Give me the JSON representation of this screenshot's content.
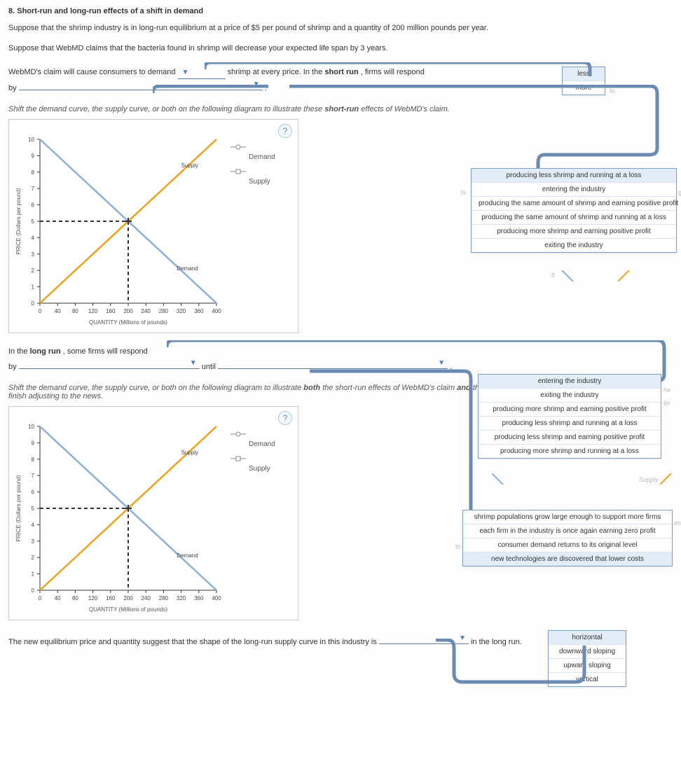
{
  "title": "8. Short-run and long-run effects of a shift in demand",
  "intro1": "Suppose that the shrimp industry is in long-run equilibrium at a price of $5 per pound of shrimp and a quantity of 200 million pounds per year.",
  "intro2": "Suppose that WebMD claims that the bacteria found in shrimp will decrease your expected life span by 3 years.",
  "sentence1_a": "WebMD's claim will cause consumers to demand ",
  "sentence1_b": " shrimp at every price. In the ",
  "sentence1_c": "short run",
  "sentence1_d": ", firms will respond",
  "sentence1_by": "by ",
  "sentence1_end": " .",
  "instr1": "Shift the demand curve, the supply curve, or both on the following diagram to illustrate these ",
  "instr1b": "short-run",
  "instr1c": " effects of WebMD's claim.",
  "sentence2_a": "In the ",
  "sentence2_b": "long run",
  "sentence2_c": ", some firms will respond",
  "sentence2_by": "by ",
  "sentence2_until": " until ",
  "sentence2_end": " .",
  "instr2a": "Shift the demand curve, the supply curve, or both on the following diagram to illustrate ",
  "instr2b": "both",
  "instr2c": " the short-run effects of WebMD's claim ",
  "instr2d": "and",
  "instr2e": " the new long-run equilibrium after firms and consumers finish adjusting to the news.",
  "sentence3_a": "The new equilibrium price and quantity suggest that the shape of the long-run supply curve in this industry is ",
  "sentence3_b": " in the long run.",
  "legend": {
    "demand": "Demand",
    "supply": "Supply"
  },
  "chart_data": [
    {
      "type": "line",
      "title": "",
      "xlabel": "QUANTITY (Millions of pounds)",
      "ylabel": "PRICE (Dollars per pound)",
      "xlim": [
        0,
        400
      ],
      "ylim": [
        0,
        10
      ],
      "x_ticks": [
        0,
        40,
        80,
        120,
        160,
        200,
        240,
        280,
        320,
        360,
        400
      ],
      "y_ticks": [
        0,
        1,
        2,
        3,
        4,
        5,
        6,
        7,
        8,
        9,
        10
      ],
      "series": [
        {
          "name": "Supply",
          "color": "#f0a020",
          "points": [
            [
              0,
              0
            ],
            [
              400,
              10
            ]
          ]
        },
        {
          "name": "Demand",
          "color": "#8ab0da",
          "points": [
            [
              0,
              10
            ],
            [
              400,
              0
            ]
          ]
        }
      ],
      "equilibrium": {
        "x": 200,
        "y": 5
      },
      "curve_labels": {
        "supply": "Supply",
        "demand": "Demand"
      }
    },
    {
      "type": "line",
      "title": "",
      "xlabel": "QUANTITY (Millions of pounds)",
      "ylabel": "PRICE (Dollars per pound)",
      "xlim": [
        0,
        400
      ],
      "ylim": [
        0,
        10
      ],
      "x_ticks": [
        0,
        40,
        80,
        120,
        160,
        200,
        240,
        280,
        320,
        360,
        400
      ],
      "y_ticks": [
        0,
        1,
        2,
        3,
        4,
        5,
        6,
        7,
        8,
        9,
        10
      ],
      "series": [
        {
          "name": "Supply",
          "color": "#f0a020",
          "points": [
            [
              0,
              0
            ],
            [
              400,
              10
            ]
          ]
        },
        {
          "name": "Demand",
          "color": "#8ab0da",
          "points": [
            [
              0,
              10
            ],
            [
              400,
              0
            ]
          ]
        }
      ],
      "equilibrium": {
        "x": 200,
        "y": 5
      },
      "curve_labels": {
        "supply": "Supply",
        "demand": "Demand"
      }
    }
  ],
  "dropdowns": {
    "d1_options": [
      "less",
      "more"
    ],
    "d2_options": [
      "producing less shrimp and running at a loss",
      "entering the industry",
      "producing the same amount of shrimp and earning positive profit",
      "producing the same amount of shrimp and running at a loss",
      "producing more shrimp and earning positive profit",
      "exiting the industry"
    ],
    "d3_options": [
      "entering the industry",
      "exiting the industry",
      "producing more shrimp and earning positive profit",
      "producing less shrimp and running at a loss",
      "producing less shrimp and earning positive profit",
      "producing more shrimp and running at a loss"
    ],
    "d4_options": [
      "shrimp populations grow large enough to support more firms",
      "each firm in the industry is once again earning zero profit",
      "consumer demand returns to its original level",
      "new technologies are discovered that lower costs"
    ],
    "d5_options": [
      "horizontal",
      "downward sloping",
      "upward sloping",
      "vertical"
    ]
  },
  "ghost": {
    "hi": "hi",
    "grar": "grar",
    "fo": "fo",
    "eight": "8",
    "D": "D",
    "he": "he",
    "iju": "iju",
    "supply": "Supply",
    "im": "im",
    "th": "th"
  },
  "help": "?"
}
